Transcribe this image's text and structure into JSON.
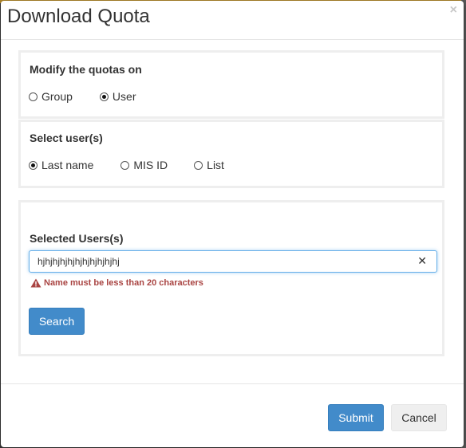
{
  "dialog": {
    "title": "Download Quota",
    "close_label": "×"
  },
  "quota_target": {
    "label": "Modify the quotas on",
    "options": [
      {
        "label": "Group",
        "checked": false
      },
      {
        "label": "User",
        "checked": true
      }
    ]
  },
  "user_select": {
    "label": "Select user(s)",
    "options": [
      {
        "label": "Last name",
        "checked": true
      },
      {
        "label": "MIS ID",
        "checked": false
      },
      {
        "label": "List",
        "checked": false
      }
    ]
  },
  "selected_users": {
    "label": "Selected Users(s)",
    "value": "hjhjhjhjhjhjhjhjhjhjhj",
    "clear_label": "✕",
    "error": "Name must be less than 20 characters",
    "search_label": "Search"
  },
  "footer": {
    "submit_label": "Submit",
    "cancel_label": "Cancel"
  },
  "colors": {
    "primary": "#428bca",
    "error": "#a94442",
    "focus": "#66afe9"
  }
}
